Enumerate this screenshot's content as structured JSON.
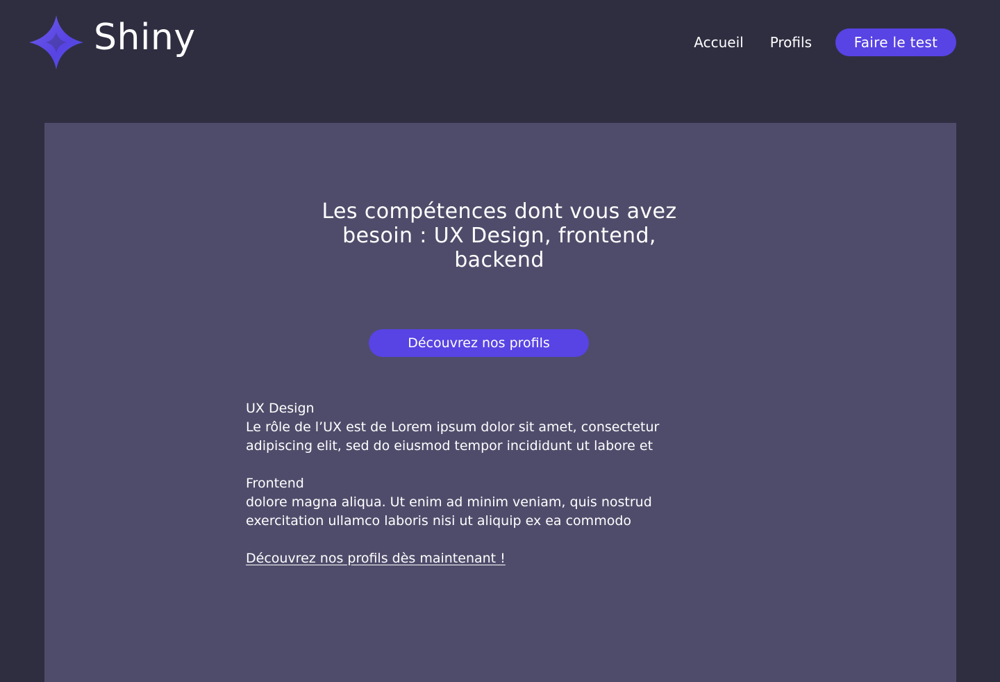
{
  "brand": {
    "name": "Shiny",
    "logo_icon": "four-point-star-icon"
  },
  "nav": {
    "links": [
      "Accueil",
      "Profils"
    ],
    "cta_label": "Faire le test"
  },
  "hero": {
    "title": "Les compétences dont vous avez besoin :  UX Design, frontend, backend",
    "button_label": "Découvrez nos profils"
  },
  "sections": [
    {
      "title": "UX Design",
      "text": "Le rôle de l’UX est de Lorem ipsum dolor sit amet, consectetur adipiscing elit, sed do eiusmod tempor incididunt ut labore et"
    },
    {
      "title": "Frontend",
      "text": "dolore magna aliqua. Ut enim ad minim veniam, quis nostrud exercitation ullamco laboris nisi ut aliquip ex ea commodo"
    }
  ],
  "cta_link": "Découvrez nos profils dès maintenant !",
  "colors": {
    "background": "#2F2E41",
    "panel": "#4F4C6B",
    "accent": "#5843E4",
    "text": "#FFFFFF"
  }
}
